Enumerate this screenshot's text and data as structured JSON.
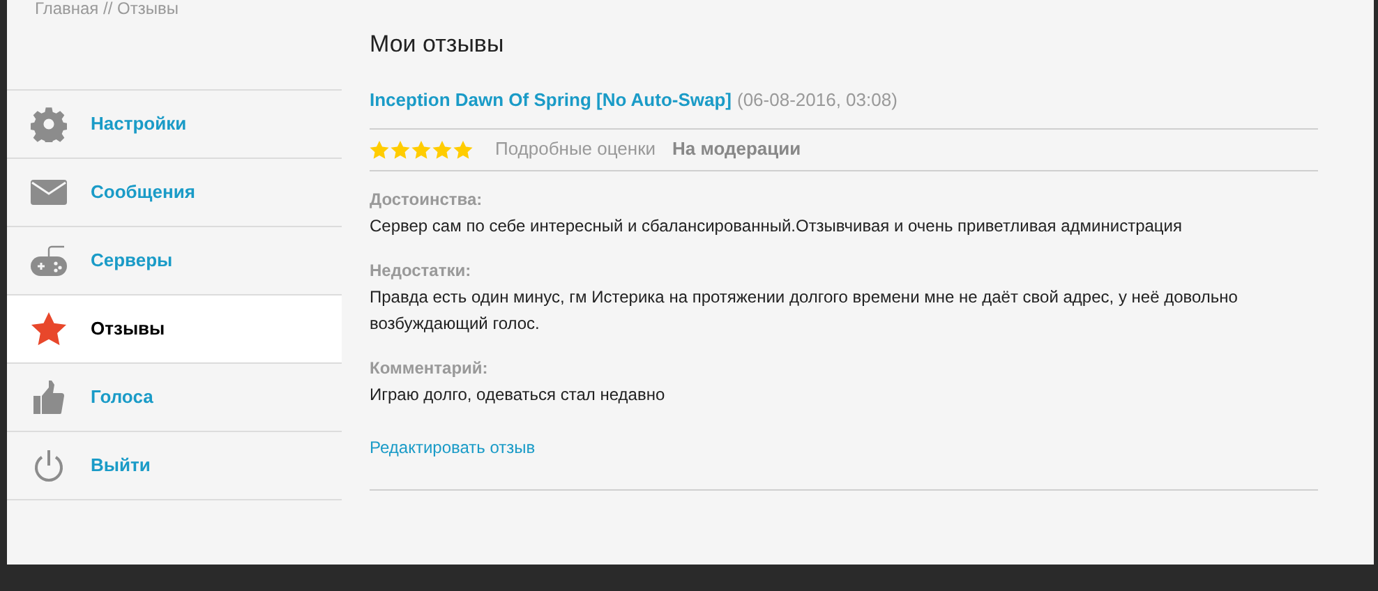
{
  "breadcrumb": "Главная // Отзывы",
  "sidebar": {
    "items": [
      {
        "kind": "gear",
        "label": "Настройки",
        "selected": false
      },
      {
        "kind": "mail",
        "label": "Сообщения",
        "selected": false
      },
      {
        "kind": "gamepad",
        "label": "Серверы",
        "selected": false
      },
      {
        "kind": "star",
        "label": "Отзывы",
        "selected": true
      },
      {
        "kind": "thumb",
        "label": "Голоса",
        "selected": false
      },
      {
        "kind": "power",
        "label": "Выйти",
        "selected": false
      }
    ]
  },
  "title": "Мои отзывы",
  "reviews": [
    {
      "server": "Inception Dawn Of Spring [No Auto-Swap]",
      "date": "(06-08-2016, 03:08)",
      "stars": 5,
      "details_link": "Подробные оценки",
      "status": "На модерации",
      "sections": [
        {
          "heading": "Достоинства:",
          "text": "Сервер сам по себе интересный и сбалансированный.Отзывчивая и очень приветливая администрация"
        },
        {
          "heading": "Недостатки:",
          "text": "Правда есть один минус, гм Истерика на протяжении долгого времени мне не даёт свой адрес, у неё довольно возбуждающий голос."
        },
        {
          "heading": "Комментарий:",
          "text": "Играю долго, одеваться стал недавно"
        }
      ],
      "edit_link": "Редактировать отзыв"
    }
  ]
}
